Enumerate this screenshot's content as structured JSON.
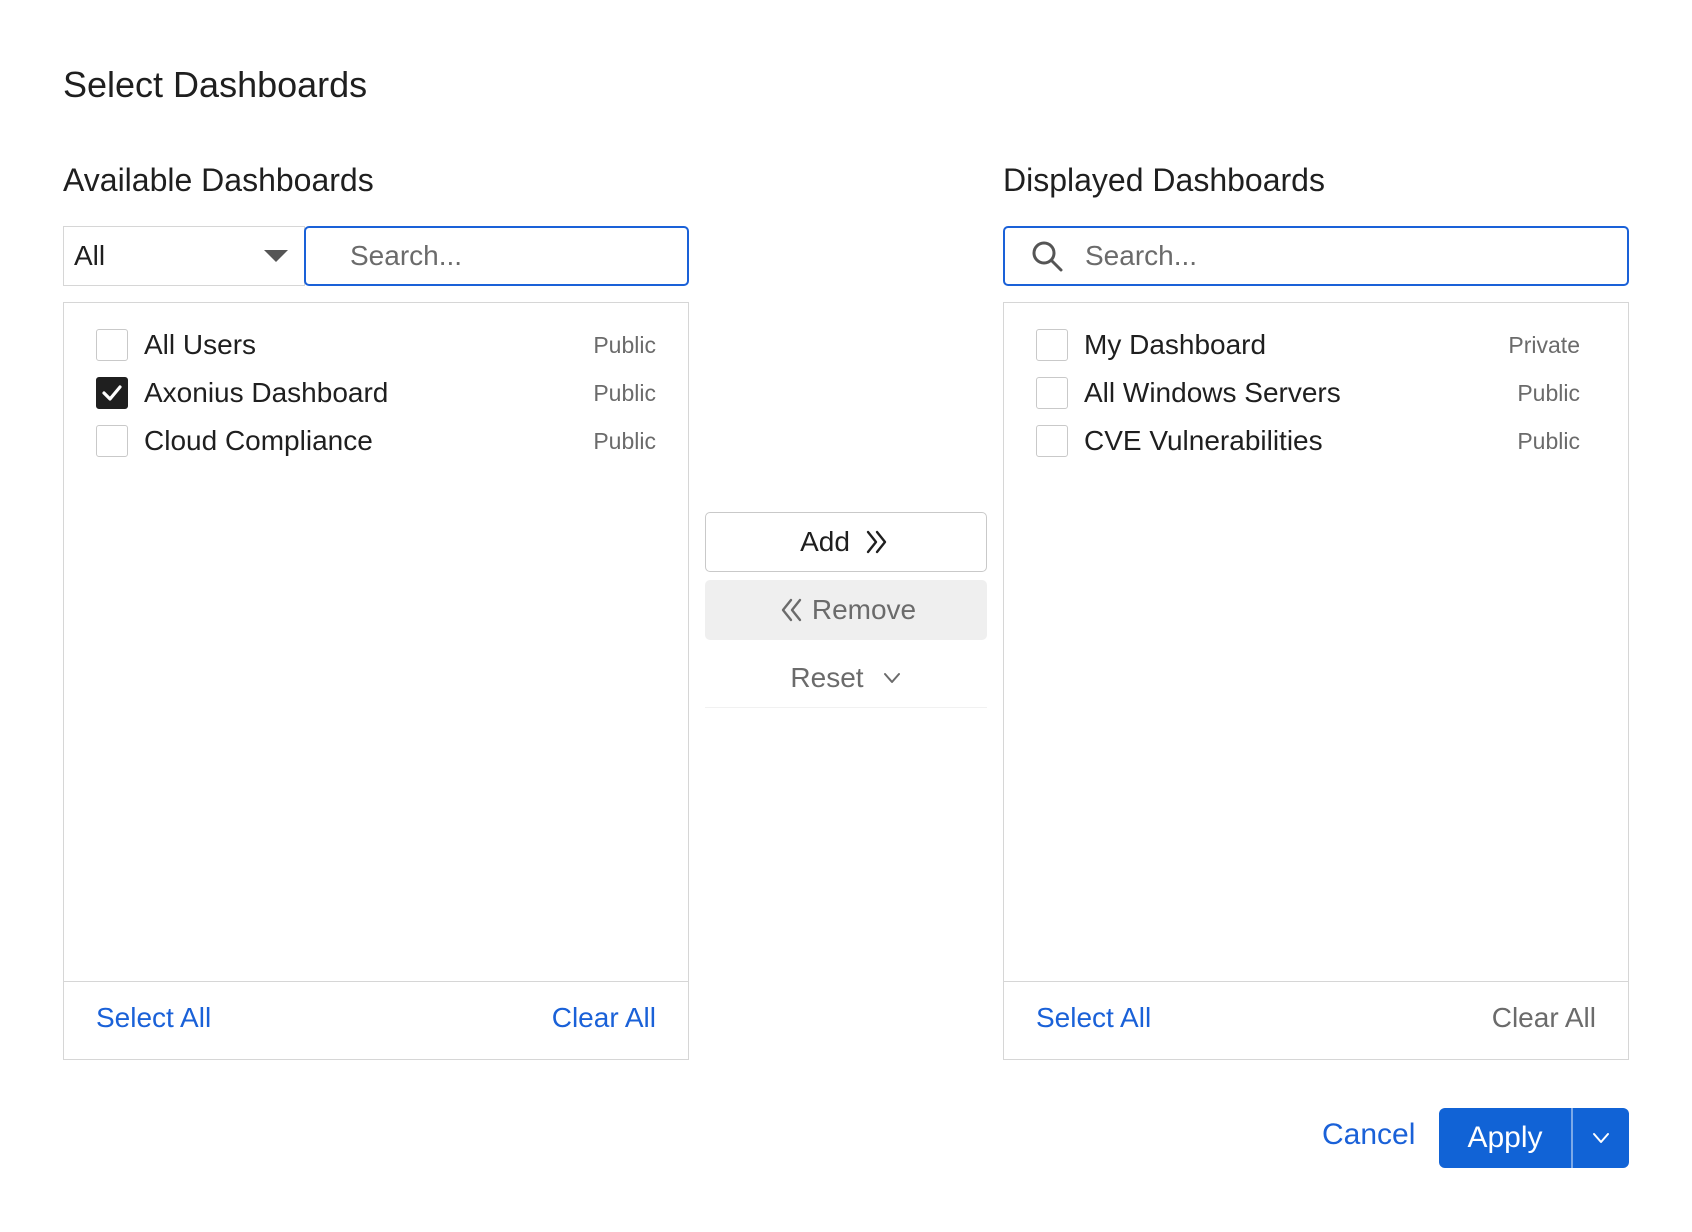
{
  "dialog": {
    "title": "Select Dashboards"
  },
  "available": {
    "title": "Available Dashboards",
    "filter_value": "All",
    "search_placeholder": "Search...",
    "items": [
      {
        "label": "All Users",
        "visibility": "Public",
        "checked": false
      },
      {
        "label": "Axonius Dashboard",
        "visibility": "Public",
        "checked": true
      },
      {
        "label": "Cloud Compliance",
        "visibility": "Public",
        "checked": false
      }
    ],
    "select_all": "Select All",
    "clear_all": "Clear All"
  },
  "displayed": {
    "title": "Displayed Dashboards",
    "search_placeholder": "Search...",
    "items": [
      {
        "label": "My Dashboard",
        "visibility": "Private",
        "checked": false
      },
      {
        "label": "All Windows Servers",
        "visibility": "Public",
        "checked": false
      },
      {
        "label": "CVE Vulnerabilities",
        "visibility": "Public",
        "checked": false
      }
    ],
    "select_all": "Select All",
    "clear_all": "Clear All"
  },
  "actions": {
    "add": "Add",
    "remove": "Remove",
    "reset": "Reset"
  },
  "footer": {
    "cancel": "Cancel",
    "apply": "Apply"
  },
  "colors": {
    "accent": "#1163d6",
    "link": "#1a61d8",
    "muted_text": "#6b6b6b",
    "border": "#d6d6d6"
  }
}
